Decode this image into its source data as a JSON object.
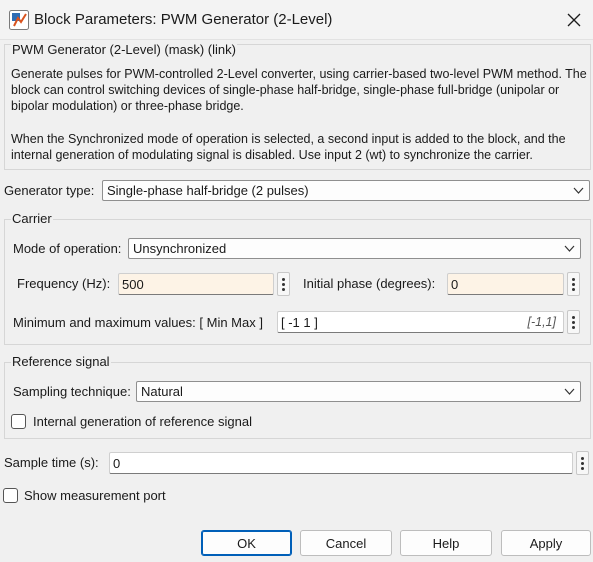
{
  "window": {
    "title": "Block Parameters: PWM Generator (2-Level)"
  },
  "description": {
    "legend": "PWM Generator (2-Level) (mask) (link)",
    "paragraph1": "Generate pulses for PWM-controlled 2-Level converter, using carrier-based two-level PWM method. The block can control switching devices of single-phase half-bridge, single-phase full-bridge (unipolar or bipolar modulation) or three-phase bridge.",
    "paragraph2": "When the Synchronized mode of operation is selected, a second input is added to the block, and the internal generation of modulating signal is disabled. Use input 2 (wt) to synchronize the carrier."
  },
  "generator_type": {
    "label": "Generator type:",
    "value": "Single-phase half-bridge (2 pulses)"
  },
  "carrier": {
    "legend": "Carrier",
    "mode_label": "Mode of operation:",
    "mode_value": "Unsynchronized",
    "frequency_label": "Frequency (Hz):",
    "frequency_value": "500",
    "phase_label": "Initial phase (degrees):",
    "phase_value": "0",
    "minmax_label": "Minimum and maximum values: [ Min  Max ]",
    "minmax_value": "[ -1  1 ]",
    "minmax_hint": "[-1,1]"
  },
  "reference": {
    "legend": "Reference signal",
    "sampling_label": "Sampling technique:",
    "sampling_value": "Natural",
    "internal_label": "Internal generation of reference signal",
    "internal_checked": false
  },
  "sample_time": {
    "label": "Sample time (s):",
    "value": "0"
  },
  "measurement": {
    "label": "Show measurement port",
    "checked": false
  },
  "buttons": {
    "ok": "OK",
    "cancel": "Cancel",
    "help": "Help",
    "apply": "Apply"
  },
  "colors": {
    "accent": "#005fb8",
    "field_highlight": "#fdf3e6",
    "background": "#f0f0f0"
  },
  "icons": {
    "app": "simulink-block-icon",
    "close": "close-icon",
    "dropdown": "chevron-down-icon",
    "more": "kebab-menu-icon"
  }
}
